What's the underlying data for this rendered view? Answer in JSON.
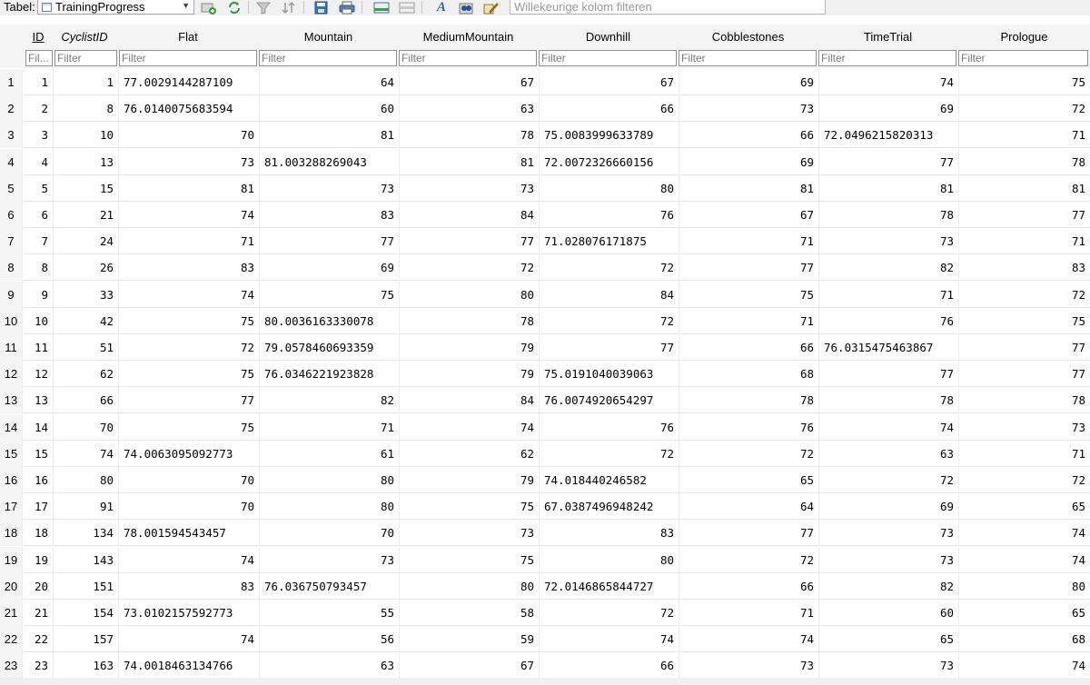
{
  "toolbar": {
    "table_label": "Tabel:",
    "table_value": "TrainingProgress",
    "filter_placeholder": "Willekeurige kolom filteren",
    "icons": [
      "add-record-icon",
      "refresh-icon",
      "clear-filters-icon",
      "sort-icon",
      "save-icon",
      "print-icon",
      "insert-icon",
      "delete-icon",
      "font-icon",
      "find-icon",
      "edit-icon"
    ]
  },
  "columns": [
    "ID",
    "CyclistID",
    "Flat",
    "Mountain",
    "MediumMountain",
    "Downhill",
    "Cobblestones",
    "TimeTrial",
    "Prologue"
  ],
  "filters": [
    "Fil...",
    "Filter",
    "Filter",
    "Filter",
    "Filter",
    "Filter",
    "Filter",
    "Filter",
    "Filter"
  ],
  "rows": [
    [
      "1",
      "1",
      "1",
      "77.0029144287109",
      "64",
      "67",
      "67",
      "69",
      "74",
      "75"
    ],
    [
      "2",
      "2",
      "8",
      "76.0140075683594",
      "60",
      "63",
      "66",
      "73",
      "69",
      "72"
    ],
    [
      "3",
      "3",
      "10",
      "70",
      "81",
      "78",
      "75.0083999633789",
      "66",
      "72.0496215820313",
      "71"
    ],
    [
      "4",
      "4",
      "13",
      "73",
      "81.003288269043",
      "81",
      "72.0072326660156",
      "69",
      "77",
      "78"
    ],
    [
      "5",
      "5",
      "15",
      "81",
      "73",
      "73",
      "80",
      "81",
      "81",
      "81"
    ],
    [
      "6",
      "6",
      "21",
      "74",
      "83",
      "84",
      "76",
      "67",
      "78",
      "77"
    ],
    [
      "7",
      "7",
      "24",
      "71",
      "77",
      "77",
      "71.028076171875",
      "71",
      "73",
      "71"
    ],
    [
      "8",
      "8",
      "26",
      "83",
      "69",
      "72",
      "72",
      "77",
      "82",
      "83"
    ],
    [
      "9",
      "9",
      "33",
      "74",
      "75",
      "80",
      "84",
      "75",
      "71",
      "72"
    ],
    [
      "10",
      "10",
      "42",
      "75",
      "80.0036163330078",
      "78",
      "72",
      "71",
      "76",
      "75"
    ],
    [
      "11",
      "11",
      "51",
      "72",
      "79.0578460693359",
      "79",
      "77",
      "66",
      "76.0315475463867",
      "77"
    ],
    [
      "12",
      "12",
      "62",
      "75",
      "76.0346221923828",
      "79",
      "75.0191040039063",
      "68",
      "77",
      "77"
    ],
    [
      "13",
      "13",
      "66",
      "77",
      "82",
      "84",
      "76.0074920654297",
      "78",
      "78",
      "78"
    ],
    [
      "14",
      "14",
      "70",
      "75",
      "71",
      "74",
      "76",
      "76",
      "74",
      "73"
    ],
    [
      "15",
      "15",
      "74",
      "74.0063095092773",
      "61",
      "62",
      "72",
      "72",
      "63",
      "71"
    ],
    [
      "16",
      "16",
      "80",
      "70",
      "80",
      "79",
      "74.018440246582",
      "65",
      "72",
      "72"
    ],
    [
      "17",
      "17",
      "91",
      "70",
      "80",
      "75",
      "67.0387496948242",
      "64",
      "69",
      "65"
    ],
    [
      "18",
      "18",
      "134",
      "78.001594543457",
      "70",
      "73",
      "83",
      "77",
      "73",
      "74"
    ],
    [
      "19",
      "19",
      "143",
      "74",
      "73",
      "75",
      "80",
      "72",
      "73",
      "74"
    ],
    [
      "20",
      "20",
      "151",
      "83",
      "76.036750793457",
      "80",
      "72.0146865844727",
      "66",
      "82",
      "80"
    ],
    [
      "21",
      "21",
      "154",
      "73.0102157592773",
      "55",
      "58",
      "72",
      "71",
      "60",
      "65"
    ],
    [
      "22",
      "22",
      "157",
      "74",
      "56",
      "59",
      "74",
      "74",
      "65",
      "68"
    ],
    [
      "23",
      "23",
      "163",
      "74.0018463134766",
      "63",
      "67",
      "66",
      "73",
      "73",
      "74"
    ]
  ]
}
